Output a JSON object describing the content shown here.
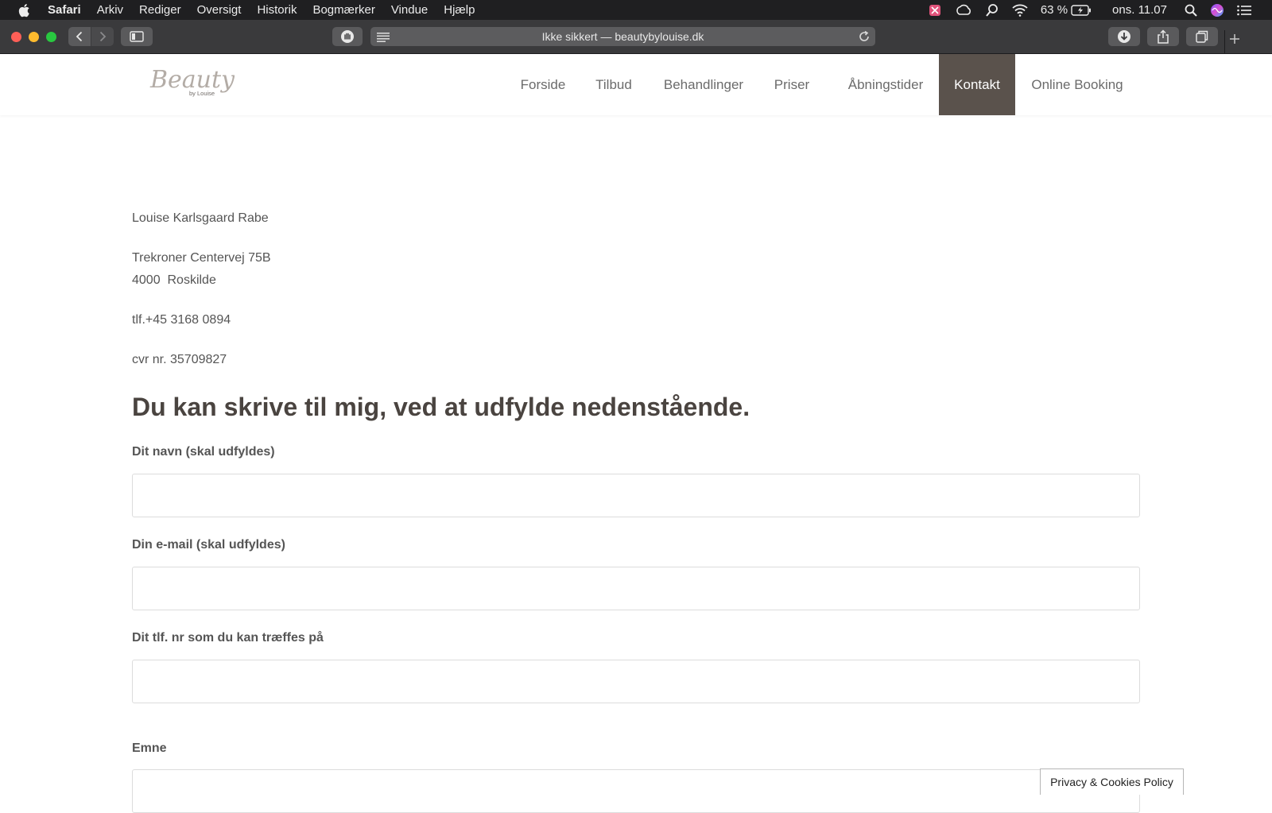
{
  "menubar": {
    "items": [
      {
        "label": "Safari"
      },
      {
        "label": "Arkiv"
      },
      {
        "label": "Rediger"
      },
      {
        "label": "Oversigt"
      },
      {
        "label": "Historik"
      },
      {
        "label": "Bogmærker"
      },
      {
        "label": "Vindue"
      },
      {
        "label": "Hjælp"
      }
    ],
    "battery": "63 %",
    "clock": "ons. 11.07"
  },
  "browser": {
    "address": "Ikke sikkert — beautybylouise.dk"
  },
  "site": {
    "logo": {
      "main": "Beauty",
      "sub": "by Louise"
    },
    "nav": [
      {
        "label": "Forside",
        "active": false
      },
      {
        "label": "Tilbud",
        "active": false
      },
      {
        "label": "Behandlinger",
        "active": false
      },
      {
        "label": "Priser",
        "active": false
      },
      {
        "label": "Åbningstider",
        "active": false
      },
      {
        "label": "Kontakt",
        "active": true
      },
      {
        "label": "Online Booking",
        "active": false
      }
    ],
    "contact": {
      "name": "Louise Karlsgaard Rabe",
      "street": "Trekroner Centervej 75B",
      "city": "4000  Roskilde",
      "phone": "tlf.+45 3168 0894",
      "cvr": "cvr nr. 35709827"
    },
    "form": {
      "heading": "Du kan skrive til mig, ved at udfylde nedenstående.",
      "fields": [
        {
          "label": "Dit navn (skal udfyldes)",
          "value": ""
        },
        {
          "label": "Din e-mail (skal udfyldes)",
          "value": ""
        },
        {
          "label": "Dit tlf. nr som du kan træffes på",
          "value": ""
        },
        {
          "label": "Emne",
          "value": ""
        }
      ]
    },
    "cookie_button": "Privacy & Cookies Policy"
  },
  "colors": {
    "nav_active_bg": "#5a524c",
    "heading": "#4a4440",
    "menubar_bg": "#1f1f21",
    "toolbar_bg": "#3a3a3c"
  }
}
